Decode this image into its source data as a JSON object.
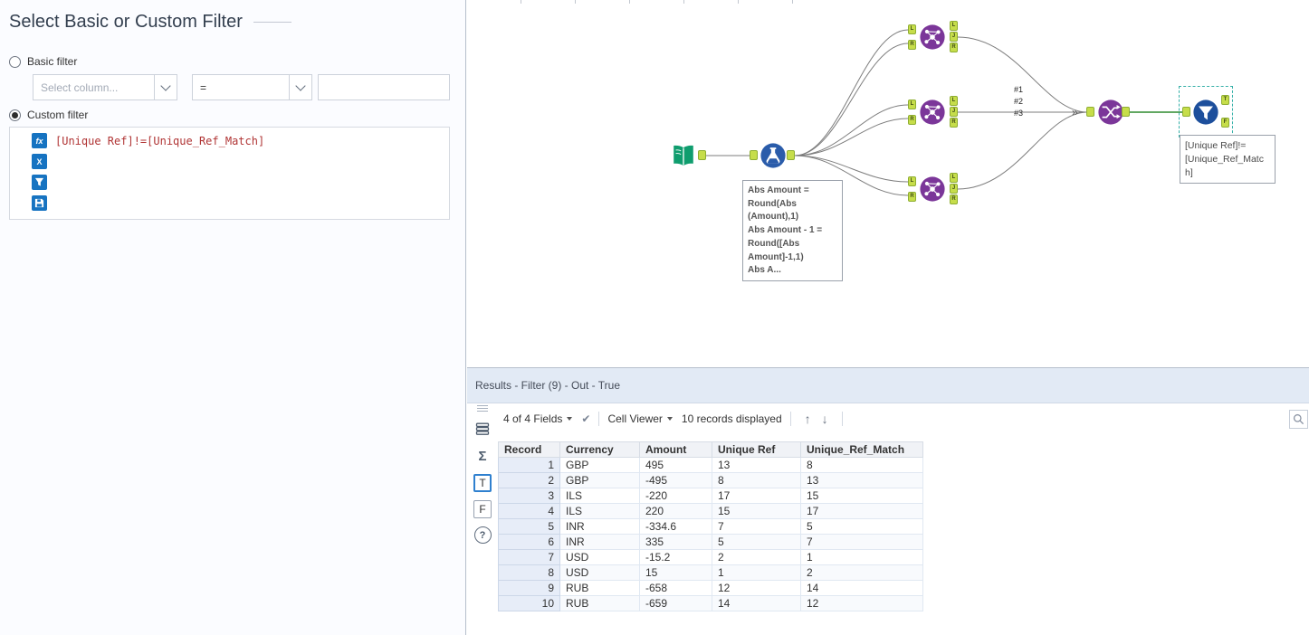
{
  "config_panel": {
    "title": "Select Basic or Custom Filter",
    "basic_filter": {
      "label": "Basic filter",
      "selected": false
    },
    "custom_filter": {
      "label": "Custom filter",
      "selected": true
    },
    "column_dropdown": {
      "placeholder": "Select column..."
    },
    "operator_dropdown": {
      "value": "="
    },
    "value_input": {
      "value": ""
    },
    "formula": "[Unique Ref]!=[Unique_Ref_Match]"
  },
  "canvas": {
    "anchors": {
      "L": "L",
      "R": "R",
      "J": "J",
      "T": "T",
      "F": "F"
    },
    "merge_marker": "»",
    "connection_order_labels": "#1\n#2\n#3",
    "formula_annotation": "Abs Amount =\nRound(Abs\n(Amount),1)\nAbs Amount - 1 =\nRound([Abs\nAmount]-1,1)\nAbs A...",
    "filter_annotation": "[Unique Ref]!=\n[Unique_Ref_Matc\nh]"
  },
  "results": {
    "header": "Results - Filter (9) - Out - True",
    "toolbar": {
      "fields_summary": "4 of 4 Fields",
      "cell_viewer": "Cell Viewer",
      "records": "10 records displayed"
    },
    "output_tabs": {
      "true": "T",
      "false": "F"
    },
    "table": {
      "columns": [
        "Record",
        "Currency",
        "Amount",
        "Unique Ref",
        "Unique_Ref_Match"
      ],
      "rows": [
        [
          "1",
          "GBP",
          "495",
          "13",
          "8"
        ],
        [
          "2",
          "GBP",
          "-495",
          "8",
          "13"
        ],
        [
          "3",
          "ILS",
          "-220",
          "17",
          "15"
        ],
        [
          "4",
          "ILS",
          "220",
          "15",
          "17"
        ],
        [
          "5",
          "INR",
          "-334.6",
          "7",
          "5"
        ],
        [
          "6",
          "INR",
          "335",
          "5",
          "7"
        ],
        [
          "7",
          "USD",
          "-15.2",
          "2",
          "1"
        ],
        [
          "8",
          "USD",
          "15",
          "1",
          "2"
        ],
        [
          "9",
          "RUB",
          "-658",
          "12",
          "14"
        ],
        [
          "10",
          "RUB",
          "-659",
          "14",
          "12"
        ]
      ]
    }
  }
}
